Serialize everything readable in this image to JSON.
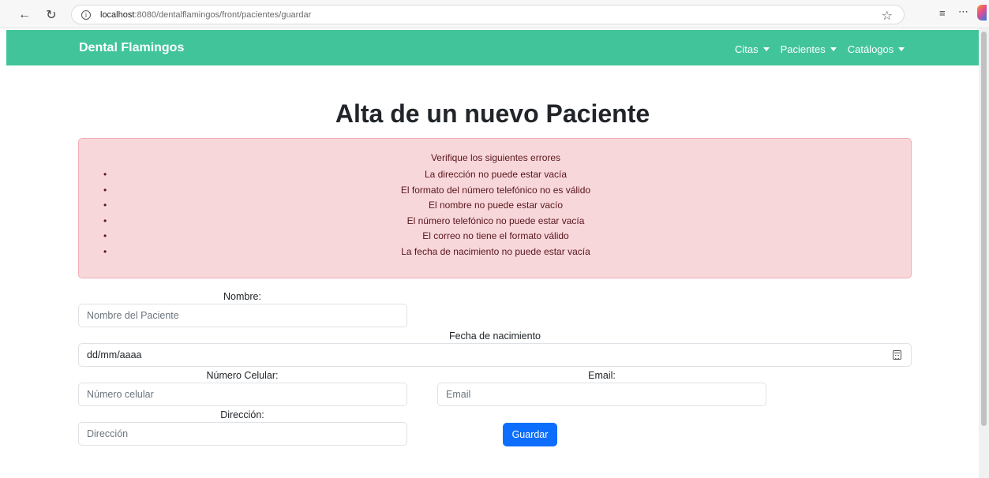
{
  "browser": {
    "url_host": "localhost",
    "url_path": ":8080/dentalflamingos/front/pacientes/guardar"
  },
  "navbar": {
    "brand": "Dental Flamingos",
    "menu": [
      "Citas",
      "Pacientes",
      "Catálogos"
    ]
  },
  "page_title": "Alta de un nuevo Paciente",
  "alert": {
    "title": "Verifique los siguientes errores",
    "errors": [
      "La dirección no puede estar vacía",
      "El formato del número telefónico no es válido",
      "El nombre no puede estar vacío",
      "El número telefónico no puede estar vacía",
      "El correo no tiene el formato válido",
      "La fecha de nacimiento no puede estar vacía"
    ]
  },
  "form": {
    "nombre_label": "Nombre:",
    "nombre_placeholder": "Nombre del Paciente",
    "fecha_label": "Fecha de nacimiento",
    "fecha_value": "dd/mm/aaaa",
    "celular_label": "Número Celular:",
    "celular_placeholder": "Número celular",
    "email_label": "Email:",
    "email_placeholder": "Email",
    "direccion_label": "Dirección:",
    "direccion_placeholder": "Dirección",
    "submit_label": "Guardar"
  },
  "colors": {
    "navbar": "#41c49a",
    "alert_bg": "#f8d7da",
    "alert_text": "#58151c",
    "button": "#0d6efd"
  }
}
